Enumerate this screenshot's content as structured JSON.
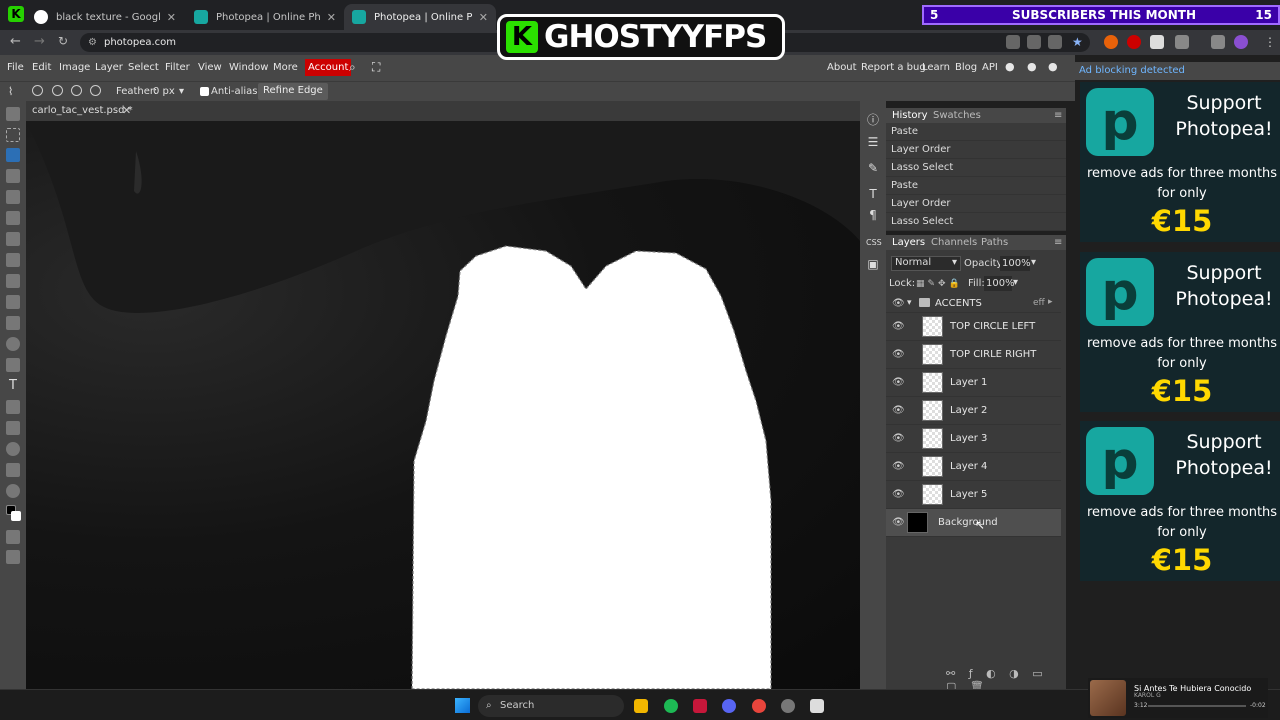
{
  "browser": {
    "tabs": [
      {
        "title": "black texture - Google Search",
        "favicon": "google-icon"
      },
      {
        "title": "Photopea | Online Photo Editor",
        "favicon": "photopea-icon"
      },
      {
        "title": "Photopea | Online Photo Editor",
        "favicon": "photopea-icon",
        "active": true
      }
    ],
    "url": "photopea.com"
  },
  "overlay": {
    "logo_text": "GHOSTYYFPS",
    "subs_count": "5",
    "subs_label": "SUBSCRIBERS THIS MONTH",
    "subs_right": "15"
  },
  "menubar": {
    "items": [
      "File",
      "Edit",
      "Image",
      "Layer",
      "Select",
      "Filter",
      "View",
      "Window",
      "More"
    ],
    "account": "Account",
    "right_links": [
      "About",
      "Report a bug",
      "Learn",
      "Blog",
      "API"
    ]
  },
  "options": {
    "feather_label": "Feather:",
    "feather_value": "0 px",
    "antialias_label": "Anti-alias",
    "refine_edge": "Refine Edge"
  },
  "document": {
    "tab_title": "carlo_tac_vest.psd *"
  },
  "history": {
    "tabs": [
      "History",
      "Swatches"
    ],
    "items": [
      "Paste",
      "Layer Order",
      "Lasso Select",
      "Paste",
      "Layer Order",
      "Lasso Select"
    ]
  },
  "layers_panel": {
    "tabs": [
      "Layers",
      "Channels",
      "Paths"
    ],
    "blend_mode": "Normal",
    "opacity_label": "Opacity:",
    "opacity_value": "100%",
    "lock_label": "Lock:",
    "fill_label": "Fill:",
    "fill_value": "100%",
    "folder": "ACCENTS",
    "fx_label": "eff",
    "layers": [
      "TOP CIRCLE LEFT",
      "TOP CIRLE RIGHT",
      "Layer 1",
      "Layer 2",
      "Layer 3",
      "Layer 4",
      "Layer 5",
      "Background"
    ]
  },
  "ads": {
    "header": "Ad blocking detected",
    "headline": "Support Photopea!",
    "desc": "remove ads for three months for only",
    "price": "€15"
  },
  "taskbar": {
    "search": "Search"
  },
  "media": {
    "title": "Si Antes Te Hubiera Conocido",
    "artist": "KAROL G",
    "elapsed": "3:12",
    "remaining": "-0:02"
  },
  "colors": {
    "accent_account": "#cc0000",
    "photopea_teal": "#17a7a0",
    "price_yellow": "#ffd800",
    "subs_purple": "#3a00a8"
  }
}
